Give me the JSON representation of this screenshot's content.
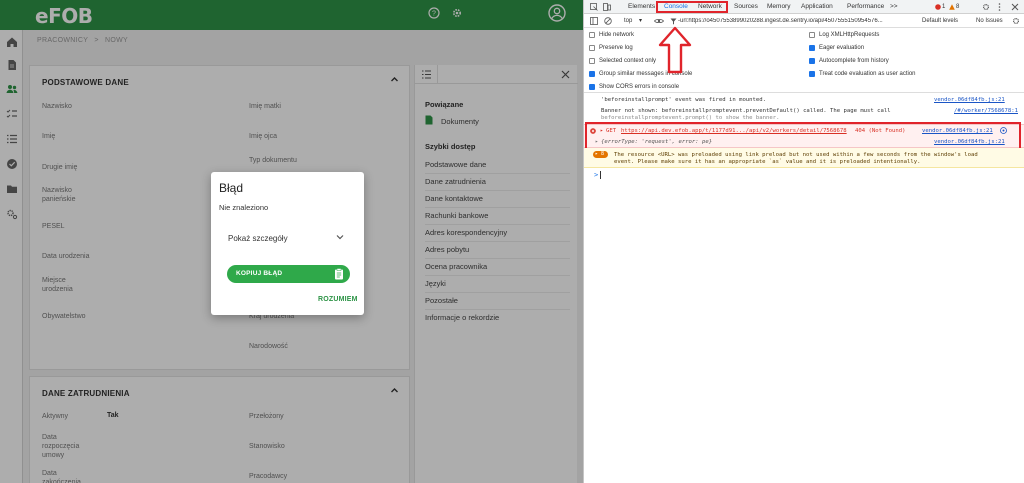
{
  "app": {
    "logo": "eFOB",
    "header_icons": [
      "help-icon",
      "settings-icon",
      "user-icon"
    ],
    "sidebar_icons": [
      "home-icon",
      "document-icon",
      "people-icon",
      "list-check-icon",
      "list-icon",
      "check-circle-icon",
      "folder-icon",
      "settings-gear-icon"
    ],
    "breadcrumb": {
      "root": "PRACOWNICY",
      "sep": ">",
      "current": "NOWY"
    },
    "basic_card": {
      "title": "PODSTAWOWE DANE",
      "left_fields": [
        "Nazwisko",
        "Imię",
        "Drugie imię",
        "Nazwisko panieńskie",
        "PESEL",
        "Data urodzenia",
        "Miejsce urodzenia",
        "Obywatelstwo"
      ],
      "right_fields": [
        "Imię matki",
        "Imię ojca",
        "Typ dokumentu",
        "Kraj urodzenia",
        "Narodowość"
      ]
    },
    "employment_card": {
      "title": "DANE ZATRUDNIENIA",
      "active_label": "Aktywny",
      "active_value": "Tak",
      "left_fields": [
        "Data rozpoczęcia umowy",
        "Data zakończenia"
      ],
      "right_fields": [
        "Przełożony",
        "Stanowisko",
        "Pracodawcy"
      ]
    },
    "right_panel": {
      "related_title": "Powiązane",
      "related_item": "Dokumenty",
      "quick_title": "Szybki dostęp",
      "quick_items": [
        "Podstawowe dane",
        "Dane zatrudnienia",
        "Dane kontaktowe",
        "Rachunki bankowe",
        "Adres korespondencyjny",
        "Adres pobytu",
        "Ocena pracownika",
        "Języki",
        "Pozostałe",
        "Informacje o rekordzie"
      ]
    },
    "dialog": {
      "title": "Błąd",
      "message": "Nie znaleziono",
      "details_label": "Pokaż szczegóły",
      "copy_label": "KOPIUJ BŁĄD",
      "ok_label": "ROZUMIEM"
    }
  },
  "devtools": {
    "tabs": [
      "Elements",
      "Console",
      "Network",
      "Sources",
      "Memory",
      "Application",
      "Performance",
      ">>"
    ],
    "active_tab": "Console",
    "highlighted_tab": "Network",
    "error_count": "1",
    "warning_count": "8",
    "toolbar": {
      "context": "top",
      "filter": "-url:https://o450755389902028​8.ingest.de.sentry.io/api/4507555150954576...",
      "levels": "Default levels",
      "issues": "No Issues"
    },
    "options_left": [
      {
        "label": "Hide network",
        "checked": false
      },
      {
        "label": "Preserve log",
        "checked": false
      },
      {
        "label": "Selected context only",
        "checked": false
      },
      {
        "label": "Group similar messages in console",
        "checked": true
      },
      {
        "label": "Show CORS errors in console",
        "checked": true
      }
    ],
    "options_right": [
      {
        "label": "Log XMLHttpRequests",
        "checked": false
      },
      {
        "label": "Eager evaluation",
        "checked": true
      },
      {
        "label": "Autocomplete from history",
        "checked": true
      },
      {
        "label": "Treat code evaluation as user action",
        "checked": true
      }
    ],
    "log1": "'beforeinstallprompt' event was fired in mounted.",
    "log1_src": "vendor.06df84fb.js:21",
    "log2a": "Banner not shown: beforeinstallpromptevent.preventDefault() called. The page must call",
    "log2b": "beforeinstallpromptevent.prompt() to show the banner.",
    "log2_src": "/#/worker/7568678:1",
    "error": {
      "method": "GET",
      "url": "https://api.dev.efob.app/t/1177d91.../api/v2/workers/detail/7568678",
      "status": "404 (Not Found)",
      "src": "vendor.06df84fb.js:21",
      "detail": "{errorType: 'request', error: pe}",
      "detail_src": "vendor.06df84fb.js:21"
    },
    "warning": {
      "line1": "The resource <URL> was preloaded using link preload but not used within a few seconds from the window's load",
      "line2": "event. Please make sure it has an appropriate `as` value and it is preloaded intentionally."
    },
    "prompt": ">"
  },
  "colors": {
    "brand": "#2e9447",
    "highlight": "#e0242b",
    "devtools_accent": "#1a73e8"
  }
}
